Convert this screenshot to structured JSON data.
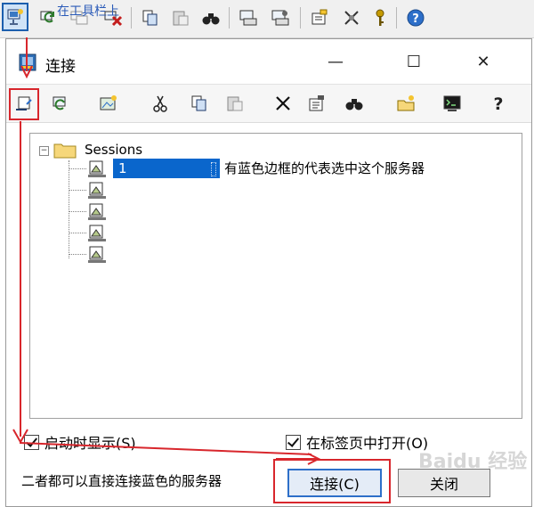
{
  "app_toolbar": {
    "annotation": "在工具栏上",
    "buttons": [
      {
        "name": "connect-icon",
        "active": true
      },
      {
        "name": "reconnect-icon"
      },
      {
        "name": "reconnect-all-icon"
      },
      {
        "name": "disconnect-icon"
      },
      {
        "name": "copy-icon"
      },
      {
        "name": "paste-icon"
      },
      {
        "name": "find-icon"
      },
      {
        "name": "print-icon"
      },
      {
        "name": "print-setup-icon"
      },
      {
        "name": "session-options-icon"
      },
      {
        "name": "global-options-icon"
      },
      {
        "name": "key-icon"
      },
      {
        "name": "help-icon"
      }
    ]
  },
  "dialog": {
    "title": "连接",
    "close_glyph": "✕",
    "maximize_glyph": "☐",
    "minimize_glyph": "—",
    "toolbar": [
      "connect-icon",
      "quick-connect-icon",
      "new-session-icon",
      "cut-icon",
      "copy-icon",
      "paste-icon",
      "delete-icon",
      "properties-icon",
      "find-icon",
      "new-folder-icon",
      "terminal-icon",
      "help-icon"
    ],
    "tree": {
      "root_label": "Sessions",
      "toggle": "−",
      "nodes": [
        {
          "label": "1",
          "selected": true
        },
        {
          "label": ""
        },
        {
          "label": ""
        },
        {
          "label": ""
        },
        {
          "label": ""
        }
      ],
      "annotation": "有蓝色边框的代表选中这个服务器"
    },
    "checkbox_startup": "启动时显示(S)",
    "checkbox_tab": "在标签页中打开(O)",
    "footer_annotation": "二者都可以直接连接蓝色的服务器",
    "connect_button": "连接(C)",
    "close_button": "关闭"
  },
  "watermark": "Baidu 经验",
  "colors": {
    "accent": "#0a66cc",
    "annotation_red": "#d8262c",
    "annotation_blue": "#2b5bb8"
  }
}
